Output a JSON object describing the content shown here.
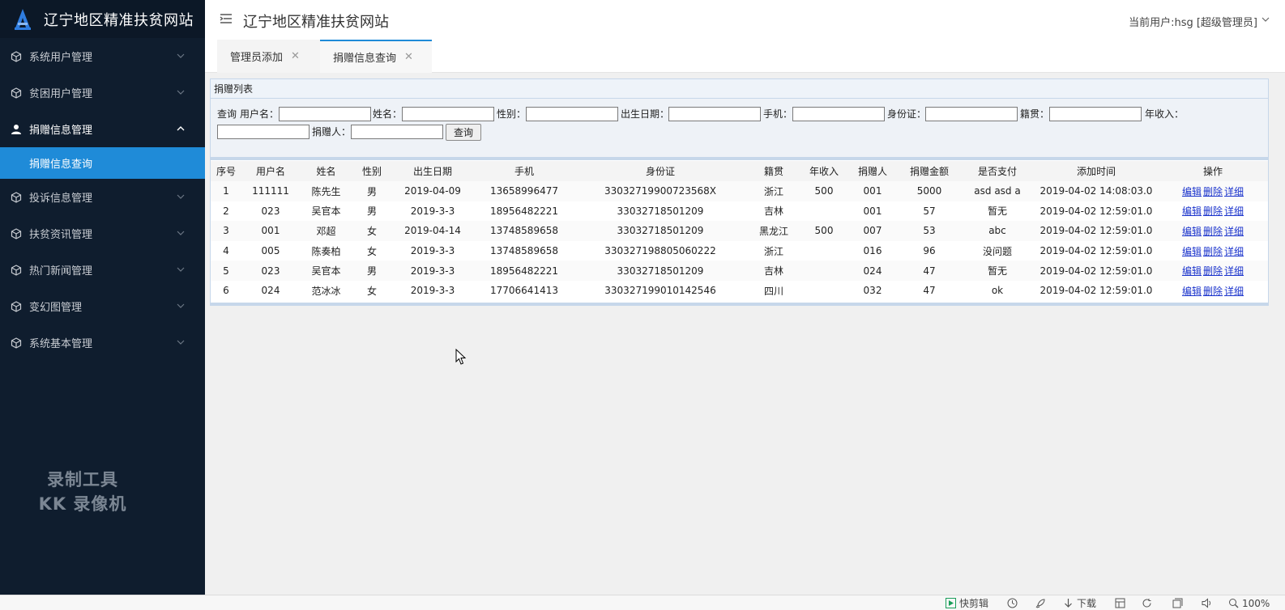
{
  "brand": {
    "title": "辽宁地区精准扶贫网站",
    "logo_icon": "a-logo-icon"
  },
  "sidebar": {
    "items": [
      {
        "label": "系统用户管理",
        "icon": "cube-icon",
        "open": false
      },
      {
        "label": "贫困用户管理",
        "icon": "cube-icon",
        "open": false
      },
      {
        "label": "捐赠信息管理",
        "icon": "user-icon",
        "open": true,
        "children": [
          {
            "label": "捐赠信息查询",
            "active": true
          }
        ]
      },
      {
        "label": "投诉信息管理",
        "icon": "cube-icon",
        "open": false
      },
      {
        "label": "扶贫资讯管理",
        "icon": "cube-icon",
        "open": false
      },
      {
        "label": "热门新闻管理",
        "icon": "cube-icon",
        "open": false
      },
      {
        "label": "变幻图管理",
        "icon": "cube-icon",
        "open": false
      },
      {
        "label": "系统基本管理",
        "icon": "cube-icon",
        "open": false
      }
    ],
    "watermark": {
      "line1": "录制工具",
      "line2": "KK 录像机"
    }
  },
  "header": {
    "title": "辽宁地区精准扶贫网站",
    "user": "当前用户:hsg [超级管理员]"
  },
  "tabs": [
    {
      "label": "管理员添加",
      "active": false
    },
    {
      "label": "捐赠信息查询",
      "active": true
    }
  ],
  "panel": {
    "title": "捐赠列表",
    "search": {
      "prefix": "查询",
      "fields": [
        {
          "label": "用户名：",
          "value": ""
        },
        {
          "label": "姓名：",
          "value": ""
        },
        {
          "label": "性别：",
          "value": ""
        },
        {
          "label": "出生日期：",
          "value": ""
        },
        {
          "label": "手机：",
          "value": ""
        },
        {
          "label": "身份证：",
          "value": ""
        },
        {
          "label": "籍贯：",
          "value": ""
        },
        {
          "label": "年收入：",
          "value": ""
        },
        {
          "label": "捐赠人：",
          "value": ""
        }
      ],
      "button": "查询"
    },
    "table": {
      "headers": [
        "序号",
        "用户名",
        "姓名",
        "性别",
        "出生日期",
        "手机",
        "身份证",
        "籍贯",
        "年收入",
        "捐赠人",
        "捐赠金额",
        "是否支付",
        "添加时间",
        "操作"
      ],
      "rows": [
        [
          "1",
          "111111",
          "陈先生",
          "男",
          "2019-04-09",
          "13658996477",
          "33032719900723568X",
          "浙江",
          "500",
          "001",
          "5000",
          "asd asd a",
          "2019-04-02 14:08:03.0"
        ],
        [
          "2",
          "023",
          "吴官本",
          "男",
          "2019-3-3",
          "18956482221",
          "33032718501209",
          "吉林",
          "",
          "001",
          "57",
          "暂无",
          "2019-04-02 12:59:01.0"
        ],
        [
          "3",
          "001",
          "邓超",
          "女",
          "2019-04-14",
          "13748589658",
          "33032718501209",
          "黑龙江",
          "500",
          "007",
          "53",
          "abc",
          "2019-04-02 12:59:01.0"
        ],
        [
          "4",
          "005",
          "陈奏柏",
          "女",
          "2019-3-3",
          "13748589658",
          "330327198805060222",
          "浙江",
          "",
          "016",
          "96",
          "没问题",
          "2019-04-02 12:59:01.0"
        ],
        [
          "5",
          "023",
          "吴官本",
          "男",
          "2019-3-3",
          "18956482221",
          "33032718501209",
          "吉林",
          "",
          "024",
          "47",
          "暂无",
          "2019-04-02 12:59:01.0"
        ],
        [
          "6",
          "024",
          "范冰冰",
          "女",
          "2019-3-3",
          "17706641413",
          "330327199010142546",
          "四川",
          "",
          "032",
          "47",
          "ok",
          "2019-04-02 12:59:01.0"
        ]
      ],
      "actions": [
        "编辑",
        "删除",
        "详细"
      ]
    }
  },
  "statusbar": {
    "items": [
      {
        "label": "快剪辑",
        "icon": "play-icon"
      },
      {
        "label": "",
        "icon": "clock-icon"
      },
      {
        "label": "",
        "icon": "rocket-icon"
      },
      {
        "label": "下载",
        "icon": "download-icon"
      },
      {
        "label": "",
        "icon": "layout-icon"
      },
      {
        "label": "",
        "icon": "refresh-icon"
      },
      {
        "label": "",
        "icon": "window-icon"
      },
      {
        "label": "",
        "icon": "speaker-icon"
      },
      {
        "label": "100%",
        "icon": "zoom-icon"
      }
    ]
  }
}
